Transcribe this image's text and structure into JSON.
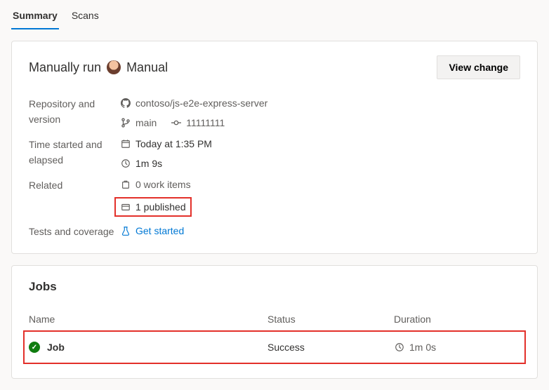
{
  "tabs": {
    "summary": "Summary",
    "scans": "Scans"
  },
  "header": {
    "prefix": "Manually run",
    "trigger": "Manual",
    "button": "View change"
  },
  "info": {
    "labels": {
      "repo": "Repository and version",
      "time": "Time started and elapsed",
      "related": "Related",
      "tests": "Tests and coverage"
    },
    "repo": "contoso/js-e2e-express-server",
    "branch": "main",
    "commit": "11111111",
    "started": "Today at 1:35 PM",
    "elapsed": "1m 9s",
    "work_items": "0 work items",
    "published": "1 published",
    "tests_link": "Get started"
  },
  "jobs": {
    "title": "Jobs",
    "columns": {
      "name": "Name",
      "status": "Status",
      "duration": "Duration"
    },
    "row": {
      "name": "Job",
      "status": "Success",
      "duration": "1m 0s"
    }
  }
}
